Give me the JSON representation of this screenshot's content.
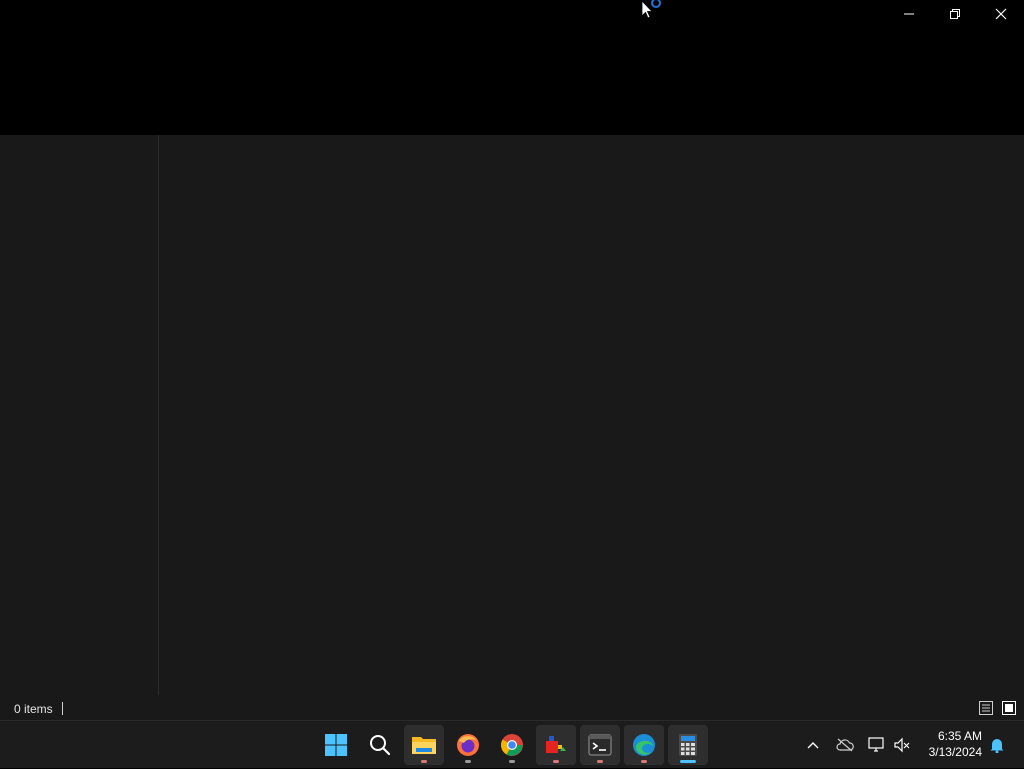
{
  "window": {
    "controls": {
      "minimize_icon": "minimize-icon",
      "restore_icon": "restore-icon",
      "close_icon": "close-icon"
    }
  },
  "statusbar": {
    "item_count": "0 items",
    "views": [
      "details-view-icon",
      "large-icons-view-icon"
    ]
  },
  "taskbar": {
    "apps": [
      {
        "name": "start",
        "icon": "windows-start-icon"
      },
      {
        "name": "search",
        "icon": "search-icon"
      },
      {
        "name": "file-explorer",
        "icon": "folder-icon"
      },
      {
        "name": "firefox",
        "icon": "firefox-icon"
      },
      {
        "name": "chrome",
        "icon": "chrome-icon"
      },
      {
        "name": "app",
        "icon": "app-icon"
      },
      {
        "name": "terminal",
        "icon": "terminal-icon"
      },
      {
        "name": "edge",
        "icon": "edge-icon"
      },
      {
        "name": "calculator",
        "icon": "calculator-icon"
      }
    ],
    "tray": {
      "time": "6:35 AM",
      "date": "3/13/2024"
    }
  },
  "colors": {
    "background": "#000000",
    "pane": "#191919",
    "taskbar": "#1c1c1c",
    "accent": "#4cc2ff"
  }
}
